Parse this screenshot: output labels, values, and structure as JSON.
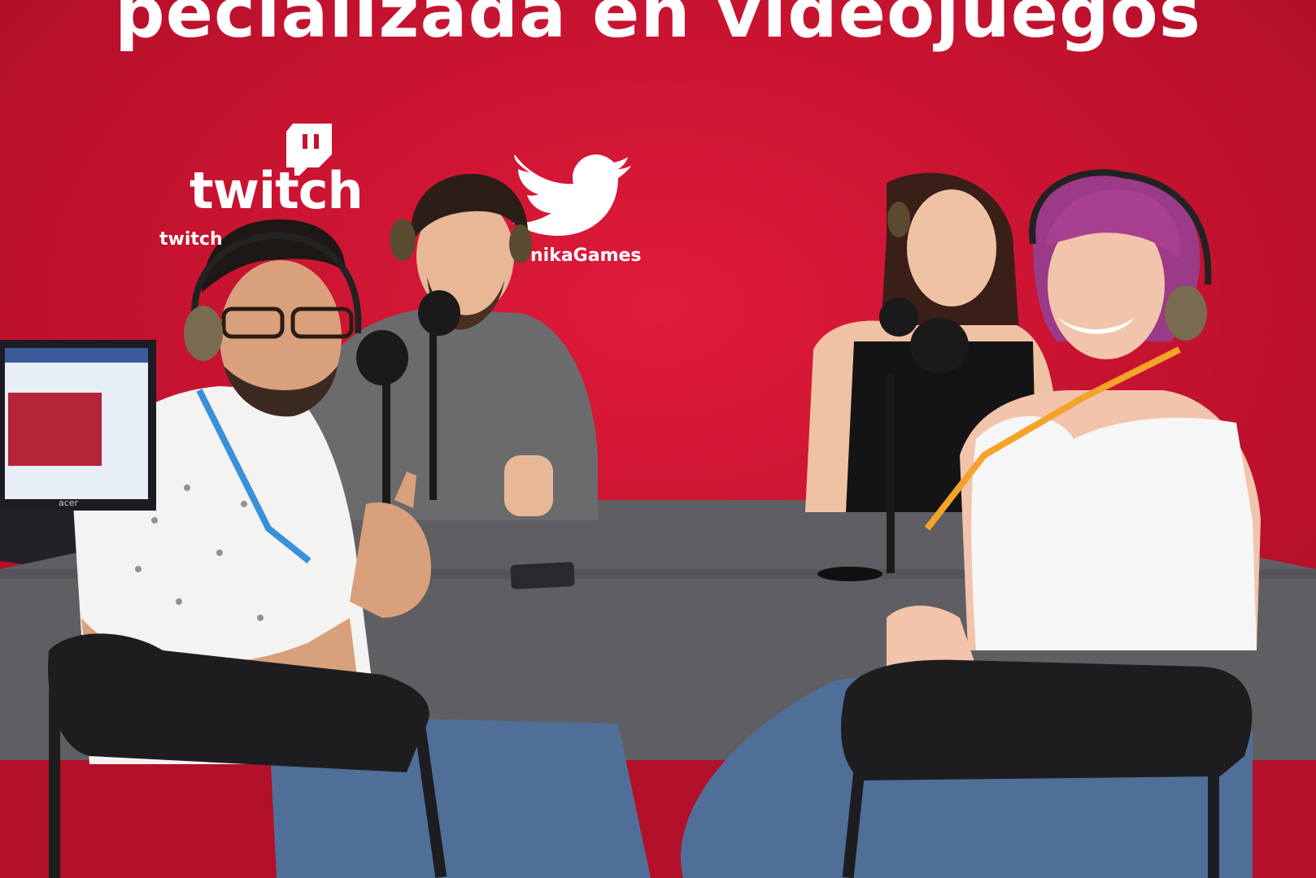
{
  "photo": {
    "banner_text": "pecializada en videojuegos",
    "twitch_word": "twitch",
    "twitch_handle": "twitch",
    "twitter_handle": "nikaGames",
    "laptop_brand": "acer"
  },
  "colors": {
    "backdrop": "#c8102e",
    "table_cloth": "#5f5f63",
    "chair": "#1d1d20",
    "denim": "#4f6f98"
  },
  "icons": [
    "twitch-logo-icon",
    "twitter-bird-icon",
    "microphone-icon",
    "headphones-icon"
  ]
}
